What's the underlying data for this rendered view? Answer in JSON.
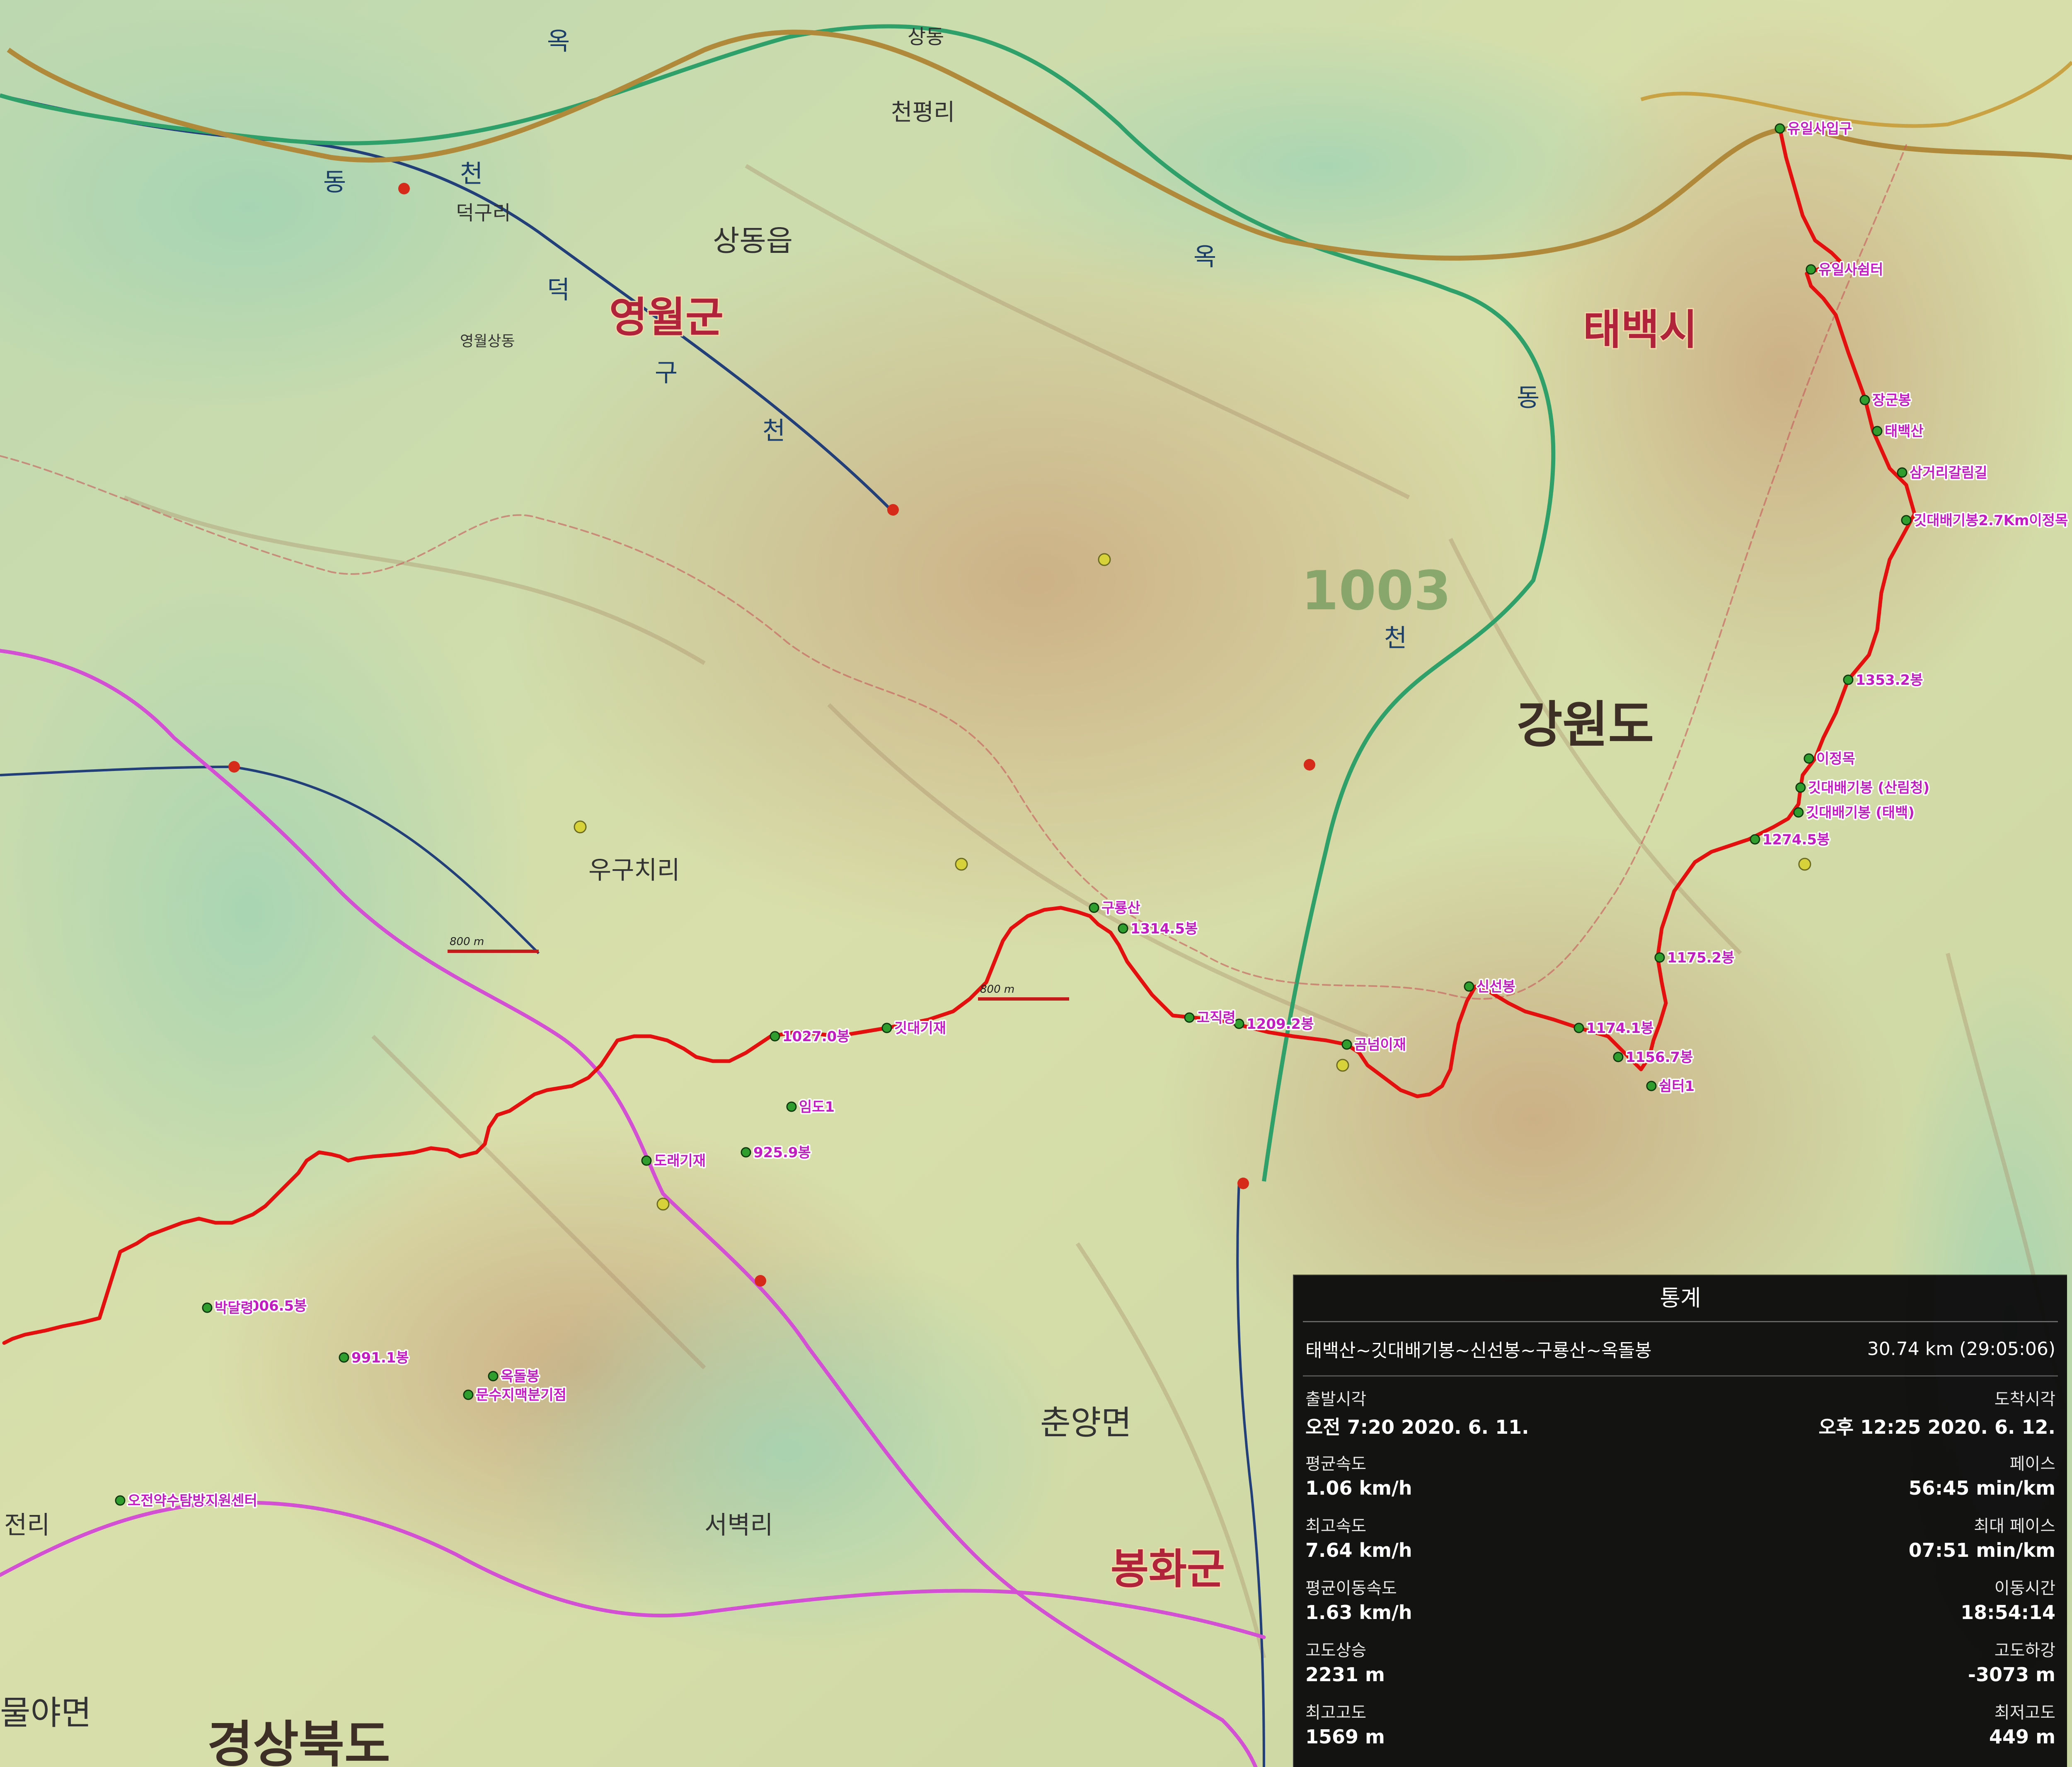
{
  "map": {
    "waypoints": [
      {
        "label": "유일사입구"
      },
      {
        "label": "유일사쉼터"
      },
      {
        "label": "장군봉"
      },
      {
        "label": "태백산"
      },
      {
        "label": "삼거리갈림길"
      },
      {
        "label": "깃대배기봉2.7Km이정목"
      },
      {
        "label": "1353.2봉"
      },
      {
        "label": "이정목"
      },
      {
        "label": "깃대배기봉 (산림청)"
      },
      {
        "label": "깃대배기봉 (태백)"
      },
      {
        "label": "1274.5봉"
      },
      {
        "label": "1175.2봉"
      },
      {
        "label": "1174.1봉"
      },
      {
        "label": "1156.7봉"
      },
      {
        "label": "쉼터1"
      },
      {
        "label": "신선봉"
      },
      {
        "label": "곰넘이재"
      },
      {
        "label": "1209.2봉"
      },
      {
        "label": "고직령"
      },
      {
        "label": "1314.5봉"
      },
      {
        "label": "구룡산"
      },
      {
        "label": "깃대기재"
      },
      {
        "label": "1027.0봉"
      },
      {
        "label": "임도1"
      },
      {
        "label": "925.9봉"
      },
      {
        "label": "도래기재"
      },
      {
        "label": "옥돌봉"
      },
      {
        "label": "문수지맥분기점"
      },
      {
        "label": "991.1봉"
      },
      {
        "label": "1006.5봉"
      },
      {
        "label": "박달령"
      },
      {
        "label": "오전약수탐방지원센터"
      }
    ],
    "places": {
      "sangdong": "상동",
      "sangdong_eup": "상동읍",
      "cheonpyeong": "천평리",
      "deokgu": "덕구리",
      "yeongwol_sangdong": "영월상동",
      "uguchi": "우구치리",
      "seobyeok": "서벽리",
      "chunyang": "춘양면",
      "jeonri": "전리",
      "mulya": "물야면"
    },
    "regions": {
      "yeongwol": "영월군",
      "taebaek": "태백시",
      "gangwon": "강원도",
      "bonghwa": "봉화군",
      "gyeongbuk": "경상북도"
    },
    "streams": [
      "옥",
      "동",
      "천",
      "덕",
      "구",
      "천",
      "옥",
      "동",
      "천"
    ],
    "contour_label": "1003",
    "scale": "800 m",
    "route_color": "#e41010",
    "waypoint_label_color": "#c21bc2",
    "boundary_color": "#d34fd3"
  },
  "stats": {
    "title": "통계",
    "route_name": "태백산~깃대배기봉~신선봉~구룡산~옥돌봉",
    "route_summary": "30.74 km (29:05:06)",
    "rows": [
      {
        "left_label": "출발시각",
        "left_value": "오전 7:20 2020. 6. 11.",
        "right_label": "도착시각",
        "right_value": "오후 12:25 2020. 6. 12."
      },
      {
        "left_label": "평균속도",
        "left_value": "1.06 km/h",
        "right_label": "페이스",
        "right_value": "56:45 min/km"
      },
      {
        "left_label": "최고속도",
        "left_value": "7.64 km/h",
        "right_label": "최대 페이스",
        "right_value": "07:51 min/km"
      },
      {
        "left_label": "평균이동속도",
        "left_value": "1.63 km/h",
        "right_label": "이동시간",
        "right_value": "18:54:14"
      },
      {
        "left_label": "고도상승",
        "left_value": "2231 m",
        "right_label": "고도하강",
        "right_value": "-3073 m"
      },
      {
        "left_label": "최고고도",
        "left_value": "1569 m",
        "right_label": "최저고도",
        "right_value": "449 m"
      }
    ]
  }
}
